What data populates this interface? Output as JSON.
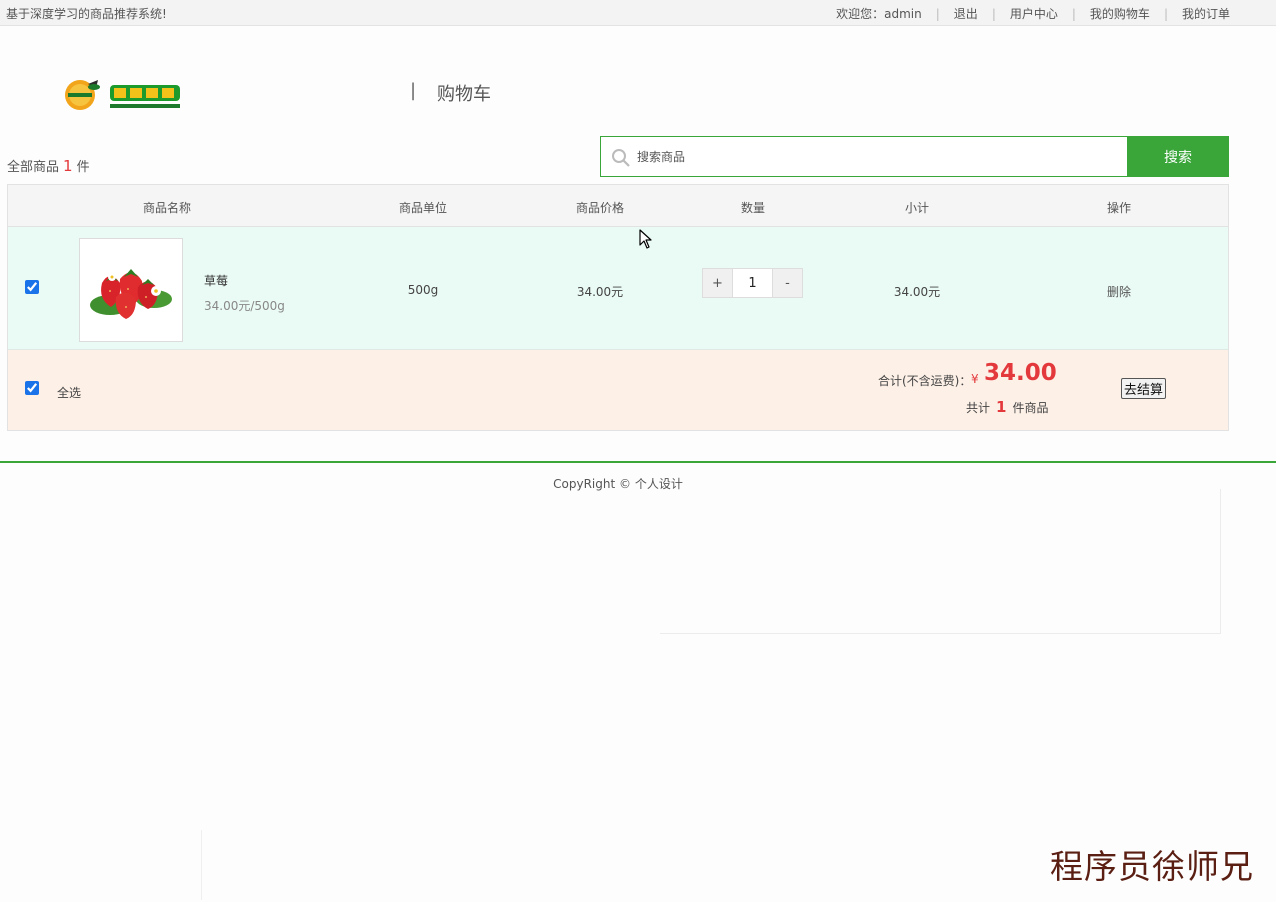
{
  "topbar": {
    "site_name": "基于深度学习的商品推荐系统!",
    "welcome": "欢迎您：admin",
    "logout": "退出",
    "user_center": "用户中心",
    "my_cart": "我的购物车",
    "my_orders": "我的订单",
    "separator": "|"
  },
  "header": {
    "logo_name": "fruit-shop-logo",
    "title_separator": "|",
    "title": "购物车"
  },
  "summary": {
    "prefix": "全部商品",
    "count": "1",
    "suffix": "件"
  },
  "search": {
    "placeholder": "搜索商品",
    "value": "",
    "button": "搜索",
    "icon": "search-icon"
  },
  "table": {
    "headers": [
      "商品名称",
      "商品单位",
      "商品价格",
      "数量",
      "小计",
      "操作"
    ],
    "rows": [
      {
        "checked": true,
        "name": "草莓",
        "desc": "34.00元/500g",
        "unit": "500g",
        "price": "34.00元",
        "qty_plus": "+",
        "qty": "1",
        "qty_minus": "-",
        "subtotal": "34.00元",
        "action": "删除"
      }
    ]
  },
  "footer_bar": {
    "select_all_checked": true,
    "select_all": "全选",
    "total_label": "合计(不含运费)：",
    "currency": "¥",
    "total": "34.00",
    "count_prefix": "共计",
    "count": "1",
    "count_suffix": "件商品",
    "checkout": "去结算"
  },
  "page_footer": {
    "copyright": "CopyRight © 个人设计"
  },
  "watermark": "程序员徐师兄",
  "colors": {
    "accent": "#3aa63a",
    "price_red": "#e4393c",
    "row_bg": "#eafaf4",
    "footer_bg": "#fdf0e7"
  }
}
